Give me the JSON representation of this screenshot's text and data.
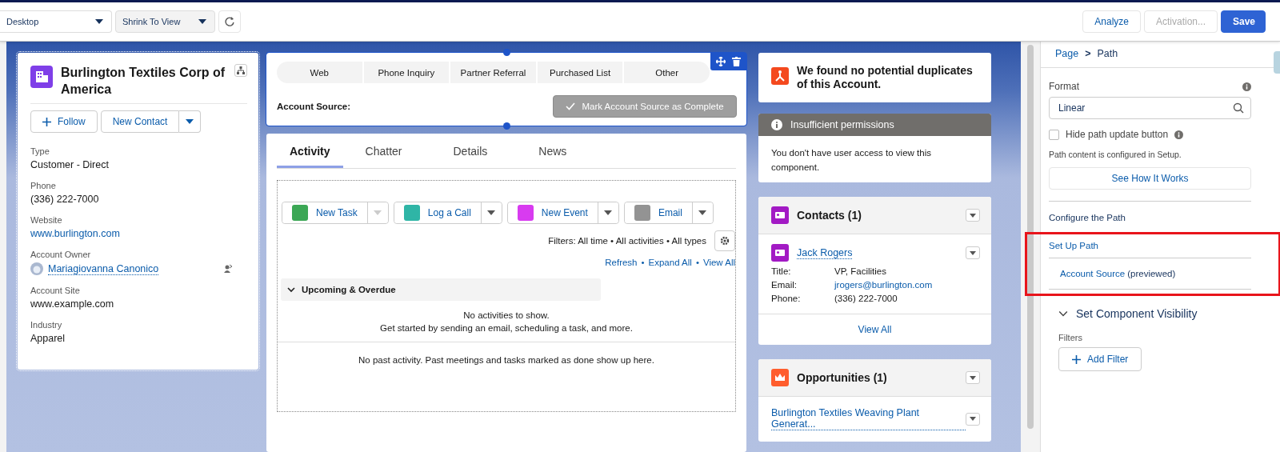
{
  "toolbar": {
    "device": "Desktop",
    "zoom": "Shrink To View",
    "buttons": [
      {
        "label": "Analyze",
        "kind": "neutral",
        "disabled": false
      },
      {
        "label": "Activation...",
        "kind": "neutral",
        "disabled": true
      },
      {
        "label": "Save",
        "kind": "brand",
        "disabled": false
      }
    ]
  },
  "account": {
    "title": "Burlington Textiles Corp of America",
    "actions": [
      "Follow",
      "New Contact"
    ],
    "fields": [
      {
        "label": "Type",
        "value": "Customer - Direct",
        "kind": "text"
      },
      {
        "label": "Phone",
        "value": "(336) 222-7000",
        "kind": "text"
      },
      {
        "label": "Website",
        "value": "www.burlington.com",
        "kind": "link"
      },
      {
        "label": "Account Owner",
        "value": "Mariagiovanna Canonico",
        "kind": "owner"
      },
      {
        "label": "Account Site",
        "value": "www.example.com",
        "kind": "text"
      },
      {
        "label": "Industry",
        "value": "Apparel",
        "kind": "text"
      }
    ]
  },
  "path": {
    "stages": [
      "Web",
      "Phone Inquiry",
      "Partner Referral",
      "Purchased List",
      "Other"
    ],
    "label": "Account Source:",
    "complete_button": {
      "label": "Mark Account Source as Complete",
      "disabled": true
    }
  },
  "tabs": [
    {
      "label": "Activity",
      "selected": true
    },
    {
      "label": "Chatter",
      "selected": false
    },
    {
      "label": "Details",
      "selected": false
    },
    {
      "label": "News",
      "selected": false
    }
  ],
  "activity": {
    "actions": [
      {
        "label": "New Task",
        "color": "#3ba755",
        "disabled": true
      },
      {
        "label": "Log a Call",
        "color": "#2fb5a6",
        "disabled": false
      },
      {
        "label": "New Event",
        "color": "#d83bf0",
        "disabled": false
      },
      {
        "label": "Email",
        "color": "#939393",
        "disabled": false
      }
    ],
    "filters": "Filters: All time • All activities • All types",
    "links": [
      "Refresh",
      "Expand All",
      "View All"
    ],
    "link_separator": "•",
    "section": {
      "title": "Upcoming & Overdue",
      "expanded": true
    },
    "empty": [
      "No activities to show.",
      "Get started by sending an email, scheduling a task, and more."
    ],
    "past": "No past activity. Past meetings and tasks marked as done show up here."
  },
  "duplicates": {
    "text": "We found no potential duplicates of this Account."
  },
  "permissions": {
    "title": "Insufficient permissions",
    "text": "You don't have user access to view this component."
  },
  "contacts": {
    "title": "Contacts (1)",
    "name": "Jack Rogers",
    "fields": [
      {
        "label": "Title:",
        "value": "VP, Facilities",
        "kind": "text"
      },
      {
        "label": "Email:",
        "value": "jrogers@burlington.com",
        "kind": "link"
      },
      {
        "label": "Phone:",
        "value": "(336) 222-7000",
        "kind": "text"
      }
    ],
    "view_all": "View All"
  },
  "opportunities": {
    "title": "Opportunities (1)",
    "item": "Burlington Textiles Weaving Plant Generat..."
  },
  "panel": {
    "breadcrumb": [
      "Page",
      "Path"
    ],
    "breadcrumb_separator": ">",
    "format_label": "Format",
    "format_value": "Linear",
    "hide_button": {
      "label": "Hide path update button",
      "checked": false
    },
    "note": "Path content is configured in Setup.",
    "how_button": "See How It Works",
    "configure": "Configure the Path",
    "setup": "Set Up Path",
    "source_link": "Account Source",
    "source_note": "(previewed)",
    "visibility": {
      "title": "Set Component Visibility",
      "expanded": true
    },
    "filters_label": "Filters",
    "add_filter": "Add Filter"
  }
}
